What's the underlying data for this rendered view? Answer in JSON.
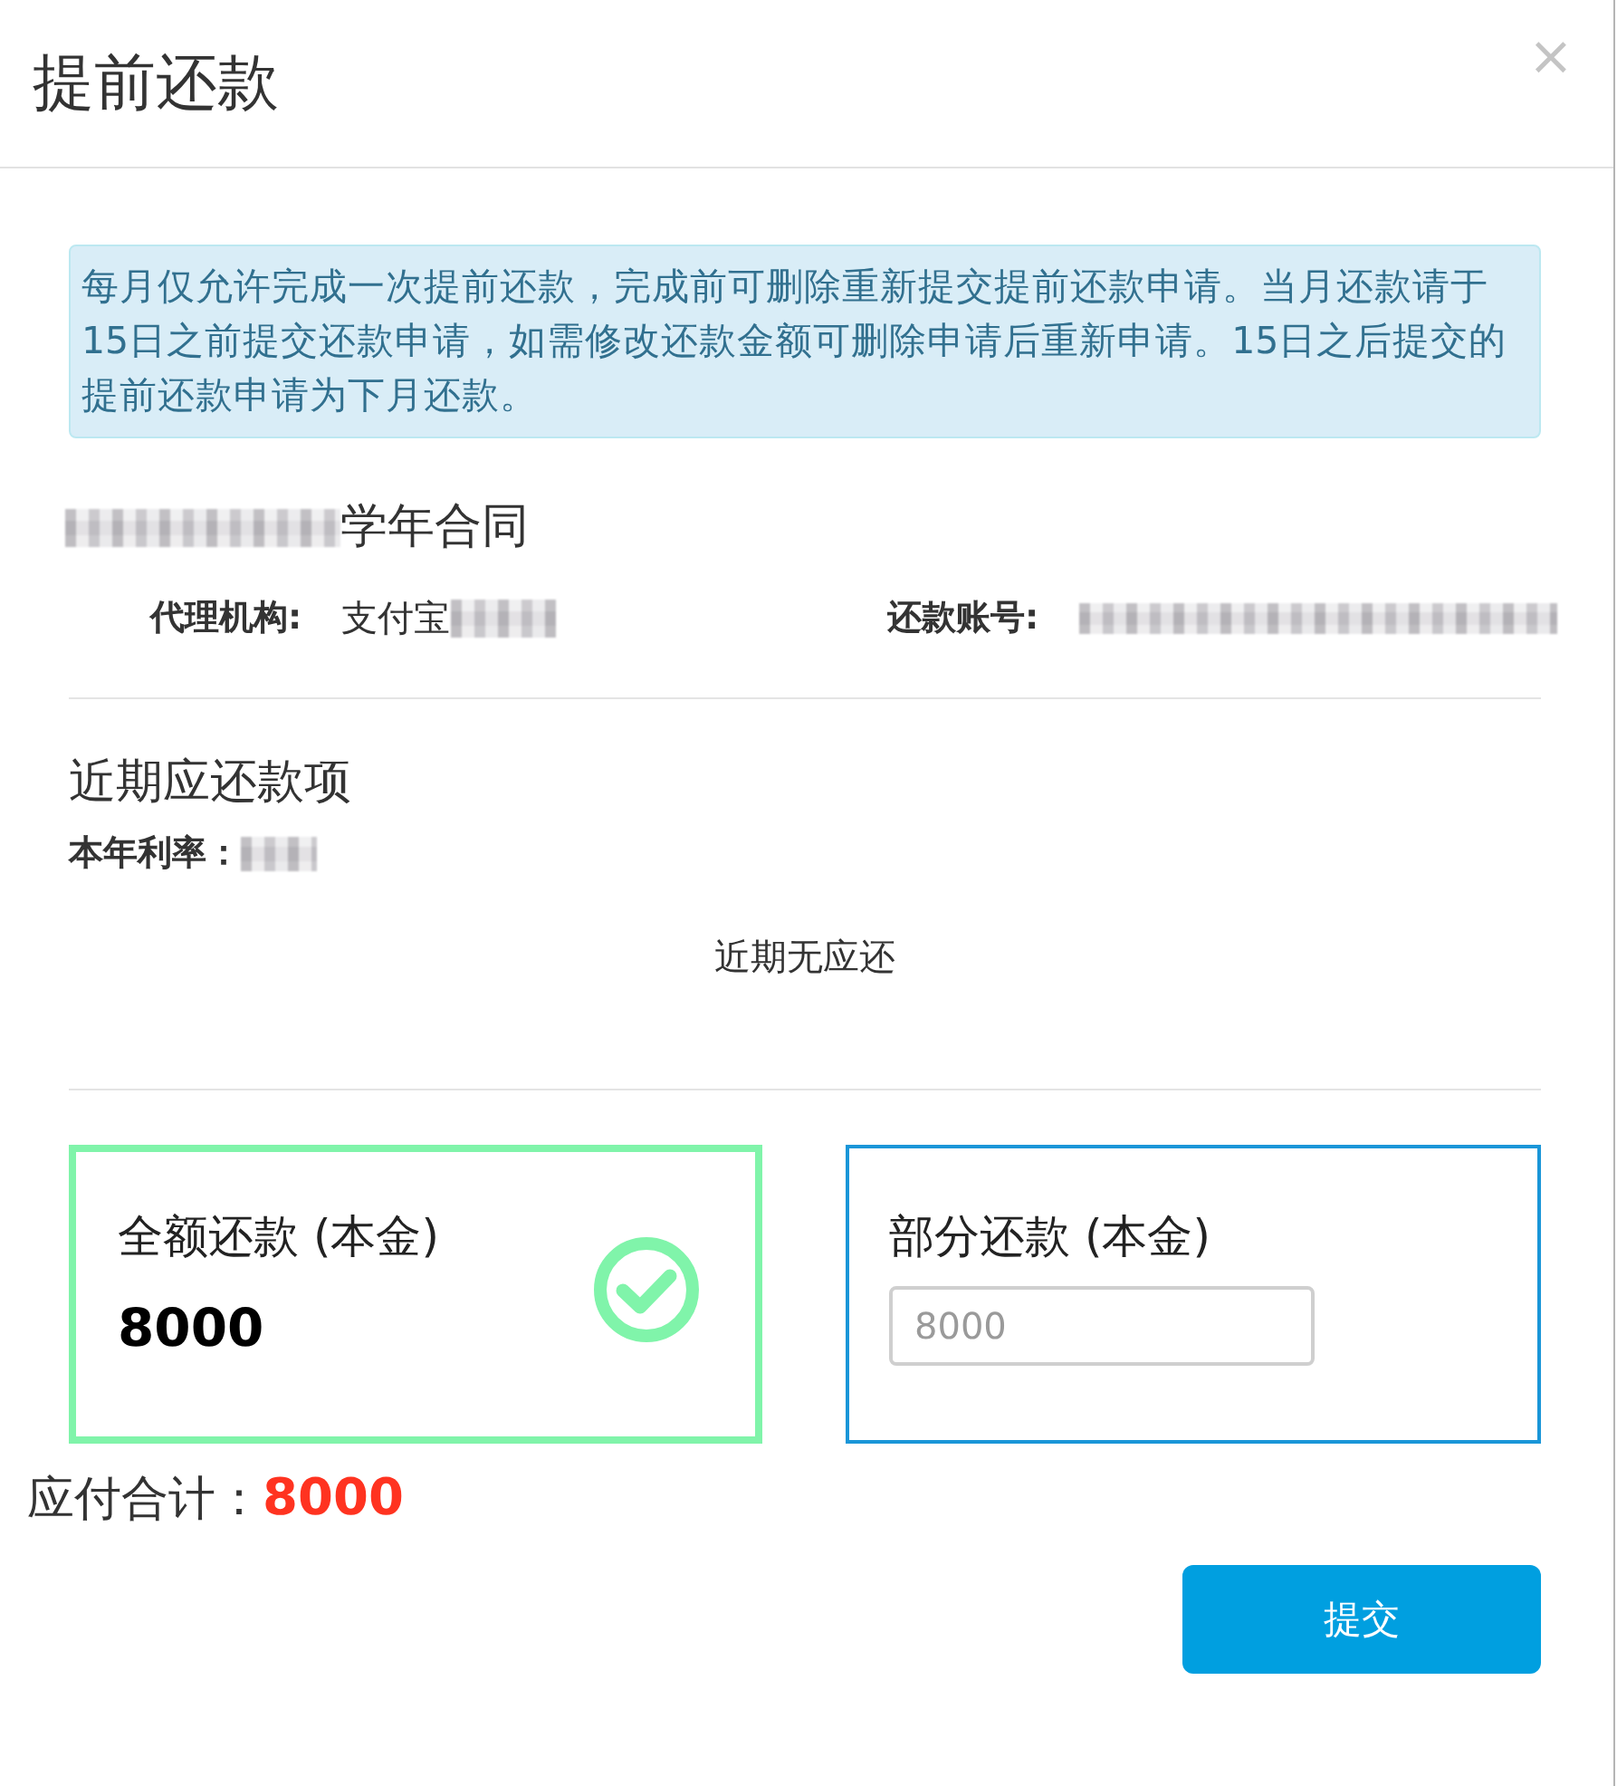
{
  "dialog": {
    "title": "提前还款",
    "close_label": "×"
  },
  "notice": "每月仅允许完成一次提前还款，完成前可删除重新提交提前还款申请。当月还款请于15日之前提交还款申请，如需修改还款金额可删除申请后重新申请。15日之后提交的提前还款申请为下月还款。",
  "contract": {
    "title": "学年合同",
    "fields": [
      {
        "label": "代理机构:",
        "value": "支付宝"
      },
      {
        "label": "还款账号:"
      }
    ]
  },
  "upcoming": {
    "heading": "近期应还款项",
    "rate_label": "本年利率：",
    "empty_message": "近期无应还"
  },
  "payment_options": [
    {
      "kind": "full",
      "label": "全额还款 (本金)",
      "amount": "8000",
      "selected": true
    },
    {
      "kind": "partial",
      "label": "部分还款 (本金)",
      "placeholder": "8000",
      "selected": false
    }
  ],
  "total": {
    "label": "应付合计：",
    "amount": "8000"
  },
  "submit_label": "提交"
}
